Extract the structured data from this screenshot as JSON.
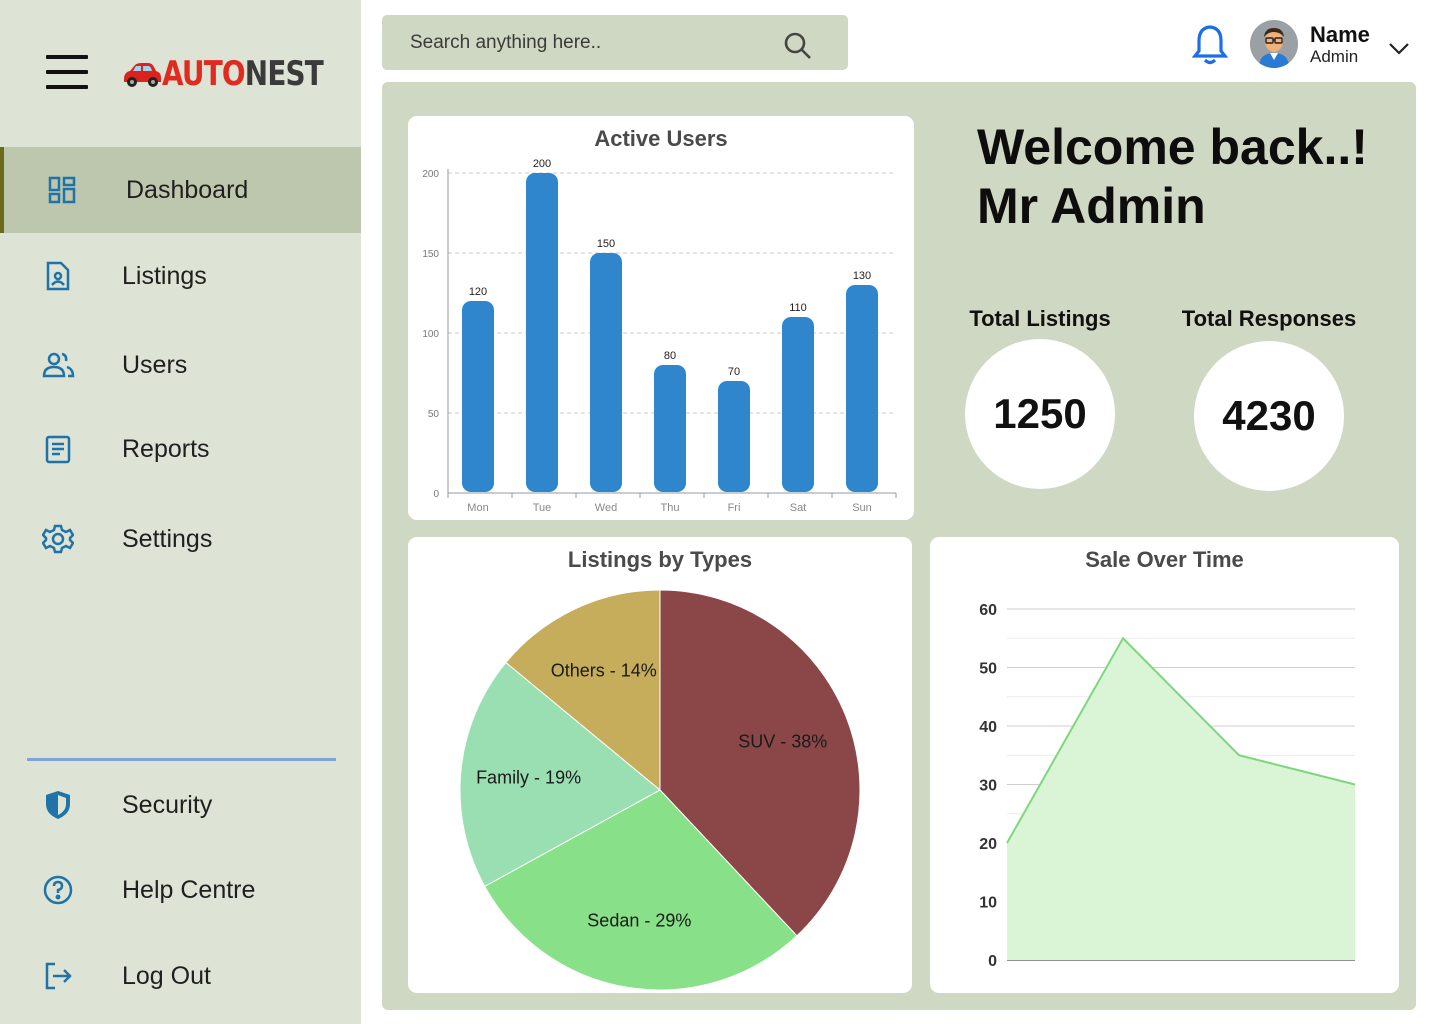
{
  "brand": {
    "prefix": "AUTO",
    "suffix": "NEST"
  },
  "sidebar": {
    "items": [
      {
        "label": "Dashboard",
        "icon": "dashboard-icon"
      },
      {
        "label": "Listings",
        "icon": "listing-doc-icon"
      },
      {
        "label": "Users",
        "icon": "users-icon"
      },
      {
        "label": "Reports",
        "icon": "report-icon"
      },
      {
        "label": "Settings",
        "icon": "gear-icon"
      }
    ],
    "bottom_items": [
      {
        "label": "Security",
        "icon": "shield-icon"
      },
      {
        "label": "Help Centre",
        "icon": "help-icon"
      },
      {
        "label": "Log Out",
        "icon": "logout-icon"
      }
    ],
    "active": "Dashboard"
  },
  "search": {
    "placeholder": "Search anything here.."
  },
  "user": {
    "name": "Name",
    "role": "Admin"
  },
  "welcome": {
    "line1": "Welcome back..!",
    "line2": "Mr Admin"
  },
  "stats": {
    "total_listings": {
      "label": "Total Listings",
      "value": "1250"
    },
    "total_responses": {
      "label": "Total Responses",
      "value": "4230"
    }
  },
  "colors": {
    "bar": "#2f86cd",
    "accent_bell": "#1a6fe8",
    "suv": "#8b4748",
    "sedan": "#88e088",
    "family": "#9adfb2",
    "others": "#c5ad5c",
    "area_line": "#7fd67f",
    "area_fill": "#d9f5d6"
  },
  "chart_data": [
    {
      "type": "bar",
      "title": "Active Users",
      "categories": [
        "Mon",
        "Tue",
        "Wed",
        "Thu",
        "Fri",
        "Sat",
        "Sun"
      ],
      "values": [
        120,
        200,
        150,
        80,
        70,
        110,
        130
      ],
      "ylim": [
        0,
        200
      ],
      "yticks": [
        0,
        50,
        100,
        150,
        200
      ],
      "grid": true
    },
    {
      "type": "pie",
      "title": "Listings by Types",
      "slices": [
        {
          "label": "SUV - 38%",
          "value": 38
        },
        {
          "label": "Sedan - 29%",
          "value": 29
        },
        {
          "label": "Family - 19%",
          "value": 19
        },
        {
          "label": "Others - 14%",
          "value": 14
        }
      ]
    },
    {
      "type": "area",
      "title": "Sale Over Time",
      "x": [
        0,
        1,
        2,
        3
      ],
      "values": [
        20,
        55,
        35,
        30
      ],
      "ylim": [
        0,
        60
      ],
      "yticks": [
        0,
        10,
        20,
        30,
        40,
        50,
        60
      ],
      "grid": true
    }
  ]
}
